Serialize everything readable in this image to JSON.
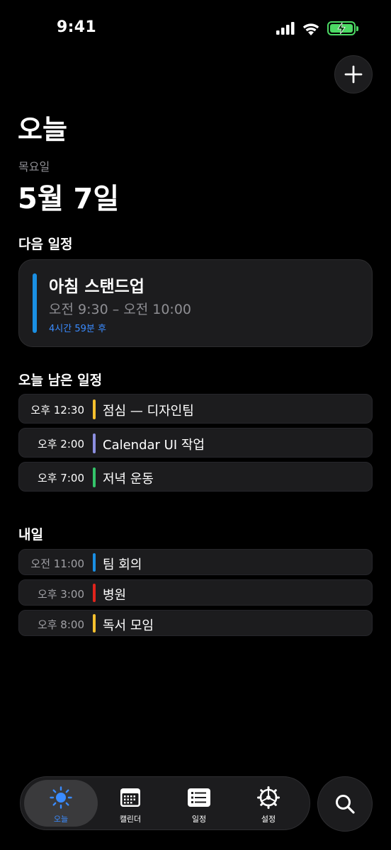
{
  "status_bar": {
    "time": "9:41"
  },
  "header": {
    "title": "오늘",
    "weekday": "목요일",
    "date": "5월 7일"
  },
  "next_event": {
    "section_title": "다음 일정",
    "title": "아침 스탠드업",
    "time": "오전 9:30 – 오전 10:00",
    "countdown": "4시간 59분 후",
    "color": "#1a8fe3"
  },
  "today_remaining": {
    "section_title": "오늘 남은 일정",
    "events": [
      {
        "time": "오후 12:30",
        "title": "점심 — 디자인팀",
        "color": "#f5c02e"
      },
      {
        "time": "오후 2:00",
        "title": "Calendar UI 작업",
        "color": "#8c8fe0"
      },
      {
        "time": "오후 7:00",
        "title": "저녁 운동",
        "color": "#34c46a"
      }
    ]
  },
  "tomorrow": {
    "section_title": "내일",
    "events": [
      {
        "time": "오전 11:00",
        "title": "팀 회의",
        "color": "#1a8fe3"
      },
      {
        "time": "오후 3:00",
        "title": "병원",
        "color": "#e0241c"
      },
      {
        "time": "오후 8:00",
        "title": "독서 모임",
        "color": "#f5c02e"
      }
    ]
  },
  "tab_bar": {
    "tabs": [
      {
        "label": "오늘",
        "icon": "sun-icon",
        "active": true
      },
      {
        "label": "캘린더",
        "icon": "calendar-icon",
        "active": false
      },
      {
        "label": "일정",
        "icon": "list-icon",
        "active": false
      },
      {
        "label": "설정",
        "icon": "gear-icon",
        "active": false
      }
    ]
  },
  "icons": {
    "add": "plus-icon",
    "search": "search-icon"
  },
  "colors": {
    "accent": "#3a8bff",
    "battery": "#4cd964"
  }
}
